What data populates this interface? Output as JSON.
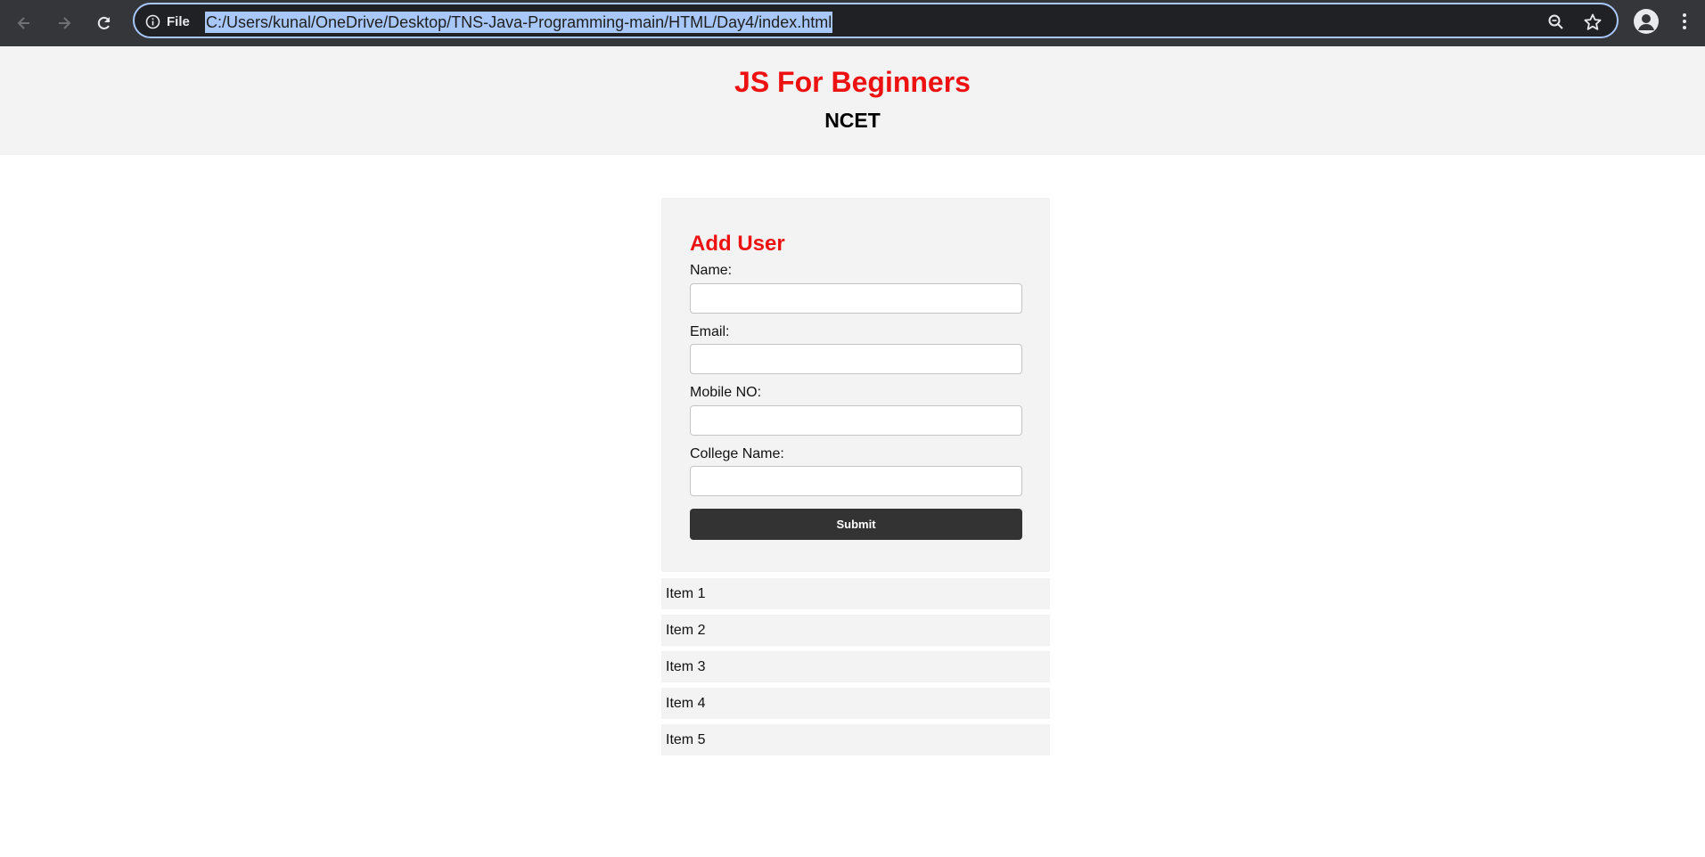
{
  "browser": {
    "site_chip_label": "File",
    "url": "C:/Users/kunal/OneDrive/Desktop/TNS-Java-Programming-main/HTML/Day4/index.html",
    "url_highlight_color": "#a8c7fa",
    "icons": [
      "back-arrow-icon",
      "forward-arrow-icon",
      "reload-icon",
      "info-icon",
      "zoom-icon",
      "star-icon",
      "profile-icon",
      "menu-dots-icon"
    ]
  },
  "header": {
    "title": "JS For Beginners",
    "subtitle": "NCET",
    "title_color": "#ee1111"
  },
  "form": {
    "title": "Add User",
    "fields": [
      {
        "label": "Name:",
        "value": ""
      },
      {
        "label": "Email:",
        "value": ""
      },
      {
        "label": "Mobile NO:",
        "value": ""
      },
      {
        "label": "College Name:",
        "value": ""
      }
    ],
    "submit_label": "Submit"
  },
  "list": {
    "items": [
      "Item 1",
      "Item 2",
      "Item 3",
      "Item 4",
      "Item 5"
    ]
  }
}
